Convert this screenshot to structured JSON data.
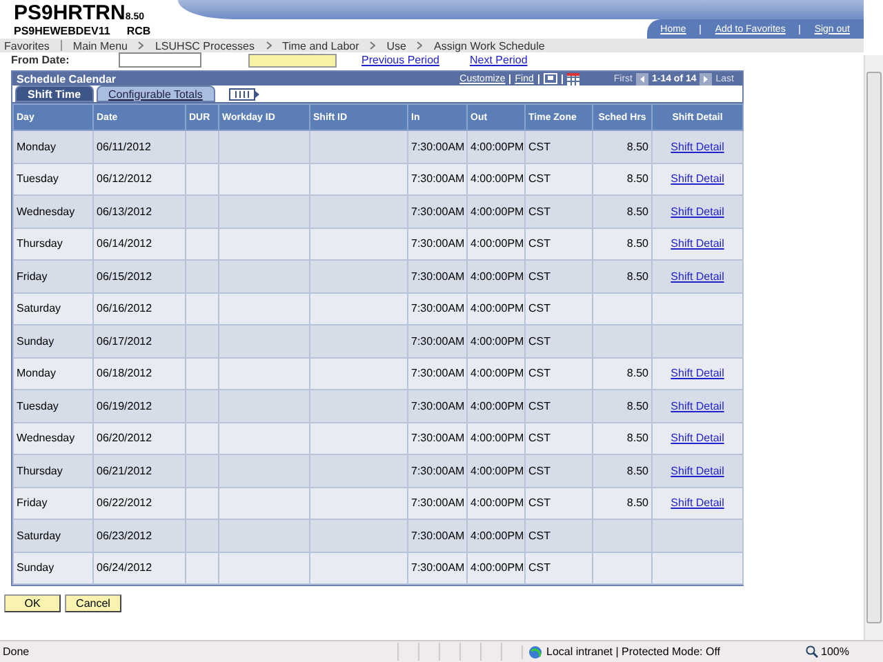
{
  "header": {
    "title": "PS9HRTRN",
    "version": "8.50",
    "server": "PS9HEWEBDEV11",
    "user": "RCB",
    "links": [
      "Home",
      "Add to Favorites",
      "Sign out"
    ]
  },
  "breadcrumbs": [
    "Favorites",
    "Main Menu",
    "LSUHSC Processes",
    "Time and Labor",
    "Use",
    "Assign Work Schedule"
  ],
  "filter": {
    "label": "From Date:",
    "previous": "Previous Period",
    "next": "Next Period"
  },
  "grid": {
    "title": "Schedule Calendar",
    "tools": [
      "Customize",
      "Find"
    ],
    "first": "First",
    "range": "1-14 of 14",
    "last": "Last",
    "tabs": [
      {
        "label": "Shift Time",
        "selected": true
      },
      {
        "label": "Configurable Totals",
        "selected": false
      }
    ],
    "columns": [
      "Day",
      "Date",
      "DUR",
      "Workday ID",
      "Shift ID",
      "In",
      "Out",
      "Time Zone",
      "Sched Hrs",
      "Shift Detail"
    ],
    "rows": [
      {
        "day": "Monday",
        "date": "06/11/2012",
        "in": "7:30:00AM",
        "out": "4:00:00PM",
        "zone": "CST",
        "hours": "8.50",
        "detail": "Shift Detail"
      },
      {
        "day": "Tuesday",
        "date": "06/12/2012",
        "in": "7:30:00AM",
        "out": "4:00:00PM",
        "zone": "CST",
        "hours": "8.50",
        "detail": "Shift Detail"
      },
      {
        "day": "Wednesday",
        "date": "06/13/2012",
        "in": "7:30:00AM",
        "out": "4:00:00PM",
        "zone": "CST",
        "hours": "8.50",
        "detail": "Shift Detail"
      },
      {
        "day": "Thursday",
        "date": "06/14/2012",
        "in": "7:30:00AM",
        "out": "4:00:00PM",
        "zone": "CST",
        "hours": "8.50",
        "detail": "Shift Detail"
      },
      {
        "day": "Friday",
        "date": "06/15/2012",
        "in": "7:30:00AM",
        "out": "4:00:00PM",
        "zone": "CST",
        "hours": "8.50",
        "detail": "Shift Detail"
      },
      {
        "day": "Saturday",
        "date": "06/16/2012",
        "in": "7:30:00AM",
        "out": "4:00:00PM",
        "zone": "CST"
      },
      {
        "day": "Sunday",
        "date": "06/17/2012",
        "in": "7:30:00AM",
        "out": "4:00:00PM",
        "zone": "CST"
      },
      {
        "day": "Monday",
        "date": "06/18/2012",
        "in": "7:30:00AM",
        "out": "4:00:00PM",
        "zone": "CST",
        "hours": "8.50",
        "detail": "Shift Detail"
      },
      {
        "day": "Tuesday",
        "date": "06/19/2012",
        "in": "7:30:00AM",
        "out": "4:00:00PM",
        "zone": "CST",
        "hours": "8.50",
        "detail": "Shift Detail"
      },
      {
        "day": "Wednesday",
        "date": "06/20/2012",
        "in": "7:30:00AM",
        "out": "4:00:00PM",
        "zone": "CST",
        "hours": "8.50",
        "detail": "Shift Detail"
      },
      {
        "day": "Thursday",
        "date": "06/21/2012",
        "in": "7:30:00AM",
        "out": "4:00:00PM",
        "zone": "CST",
        "hours": "8.50",
        "detail": "Shift Detail"
      },
      {
        "day": "Friday",
        "date": "06/22/2012",
        "in": "7:30:00AM",
        "out": "4:00:00PM",
        "zone": "CST",
        "hours": "8.50",
        "detail": "Shift Detail"
      },
      {
        "day": "Saturday",
        "date": "06/23/2012",
        "in": "7:30:00AM",
        "out": "4:00:00PM",
        "zone": "CST"
      },
      {
        "day": "Sunday",
        "date": "06/24/2012",
        "in": "7:30:00AM",
        "out": "4:00:00PM",
        "zone": "CST"
      }
    ]
  },
  "buttons": [
    "OK",
    "Cancel"
  ],
  "status_bar": {
    "text": "Done",
    "zone": "Local intranet | Protected Mode: Off",
    "zoom": "100%"
  }
}
